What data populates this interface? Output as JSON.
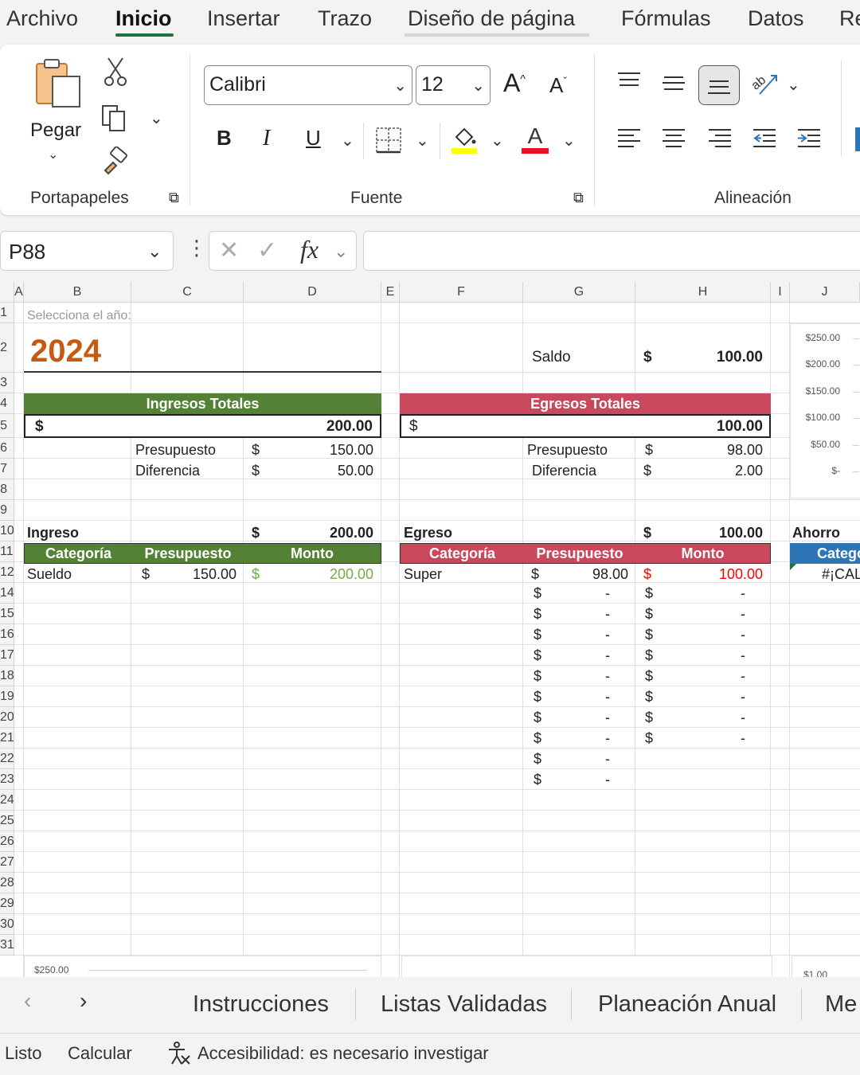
{
  "menu": {
    "tabs": [
      "Archivo",
      "Inicio",
      "Insertar",
      "Trazo",
      "Diseño de página",
      "Fórmulas",
      "Datos",
      "Re"
    ],
    "active": "Inicio"
  },
  "ribbon": {
    "paste_label": "Pegar",
    "groups": {
      "clipboard": "Portapapeles",
      "font": "Fuente",
      "alignment": "Alineación"
    },
    "font_name": "Calibri",
    "font_size": "12",
    "bold": "B",
    "italic": "I",
    "underline": "U",
    "grow_font": "A",
    "shrink_font": "A",
    "font_color_letter": "A",
    "fill_color": "#ffff00",
    "font_color": "#e81123"
  },
  "formula_bar": {
    "name_box": "P88",
    "fx": "fx",
    "formula": ""
  },
  "columns": [
    "A",
    "B",
    "C",
    "D",
    "E",
    "F",
    "G",
    "H",
    "I",
    "J"
  ],
  "rows": [
    "1",
    "2",
    "3",
    "4",
    "5",
    "6",
    "7",
    "8",
    "9",
    "10",
    "11",
    "12",
    "13",
    "14",
    "15",
    "16",
    "17",
    "18",
    "19",
    "20",
    "21",
    "22",
    "23",
    "24",
    "25",
    "26",
    "27",
    "28",
    "29",
    "30",
    "31"
  ],
  "sheet": {
    "year_prompt": "Selecciona el año:",
    "year": "2024",
    "saldo_label": "Saldo",
    "saldo_cur": "$",
    "saldo_value": "100.00",
    "ingresos_title": "Ingresos Totales",
    "ingresos_cur": "$",
    "ingresos_total": "200.00",
    "egresos_title": "Egresos Totales",
    "egresos_cur": "$",
    "egresos_total": "100.00",
    "in_presupuesto_label": "Presupuesto",
    "in_presupuesto_cur": "$",
    "in_presupuesto_value": "150.00",
    "in_diferencia_label": "Diferencia",
    "in_diferencia_cur": "$",
    "in_diferencia_value": "50.00",
    "eg_presupuesto_label": "Presupuesto",
    "eg_presupuesto_cur": "$",
    "eg_presupuesto_value": "98.00",
    "eg_diferencia_label": "Diferencia",
    "eg_diferencia_cur": "$",
    "eg_diferencia_value": "2.00",
    "ingreso_label": "Ingreso",
    "ingreso_cur": "$",
    "ingreso_value": "200.00",
    "egreso_label": "Egreso",
    "egreso_cur": "$",
    "egreso_value": "100.00",
    "ahorro_label": "Ahorro",
    "hdr_categoria": "Categoría",
    "hdr_presupuesto": "Presupuesto",
    "hdr_monto": "Monto",
    "hdr_ahorro_categoria": "Catego",
    "in_row_cat": "Sueldo",
    "in_row_pres_cur": "$",
    "in_row_pres": "150.00",
    "in_row_monto_cur": "$",
    "in_row_monto": "200.00",
    "eg_row_cat": "Super",
    "eg_row_pres_cur": "$",
    "eg_row_pres": "98.00",
    "eg_row_monto_cur": "$",
    "eg_row_monto": "100.00",
    "ahorro_row": "#¡CAL",
    "dash": "-",
    "cur": "$"
  },
  "chart_top": {
    "y_ticks": [
      "$250.00",
      "$200.00",
      "$150.00",
      "$100.00",
      "$50.00",
      "$-"
    ]
  },
  "chart_bottom_left": {
    "y_tick": "$250.00"
  },
  "chart_bottom_right": {
    "y_tick": "$1.00"
  },
  "colors": {
    "green": "#538135",
    "red": "#c9485b",
    "blue": "#2e75b6",
    "orange": "#c55a11",
    "green_text": "#70ad47",
    "red_text": "#ff0000"
  },
  "sheet_tabs": [
    "Instrucciones",
    "Listas Validadas",
    "Planeación Anual",
    "Me"
  ],
  "status": {
    "ready": "Listo",
    "calculate": "Calcular",
    "accessibility": "Accesibilidad: es necesario investigar"
  }
}
